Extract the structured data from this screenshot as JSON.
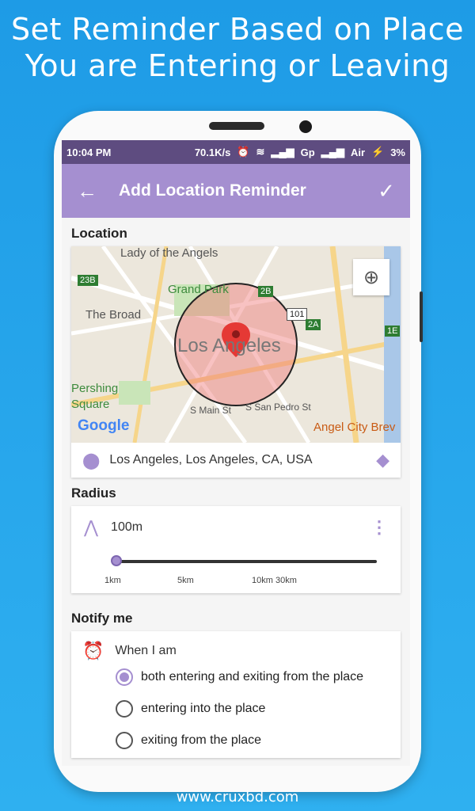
{
  "headline": {
    "line1": "Set Reminder Based on Place",
    "line2": "You are Entering or Leaving"
  },
  "footer": "www.cruxbd.com",
  "status_bar": {
    "time": "10:04 PM",
    "speed": "70.1K/s",
    "carrier1": "Gp",
    "carrier2": "Air",
    "battery": "3%"
  },
  "app_bar": {
    "title": "Add Location Reminder",
    "back_icon": "arrow-back-icon",
    "confirm_icon": "check-icon"
  },
  "location": {
    "label": "Location",
    "map": {
      "place_labels": [
        "Lady of the Angels",
        "Grand Park",
        "The Broad",
        "Los Angeles",
        "Pershing Square",
        "Angel City Brev",
        "S Main St",
        "S San Pedro St"
      ],
      "route_badges": [
        "23B",
        "2B",
        "101",
        "2A",
        "1E"
      ],
      "brand": "Google"
    },
    "address": "Los Angeles, Los Angeles, CA, USA"
  },
  "radius": {
    "label": "Radius",
    "value": "100m",
    "ticks": [
      "1km",
      "5km",
      "10km",
      "30km"
    ],
    "slider_fraction": 0.0
  },
  "notify": {
    "label": "Notify me",
    "when_label": "When I am",
    "options": [
      {
        "label": "both entering and exiting from the place",
        "selected": true
      },
      {
        "label": "entering into the place",
        "selected": false
      },
      {
        "label": "exiting from the place",
        "selected": false
      }
    ]
  },
  "colors": {
    "accent": "#a58fd0",
    "status_bar": "#5e4c80",
    "background": "#1e9be6"
  }
}
